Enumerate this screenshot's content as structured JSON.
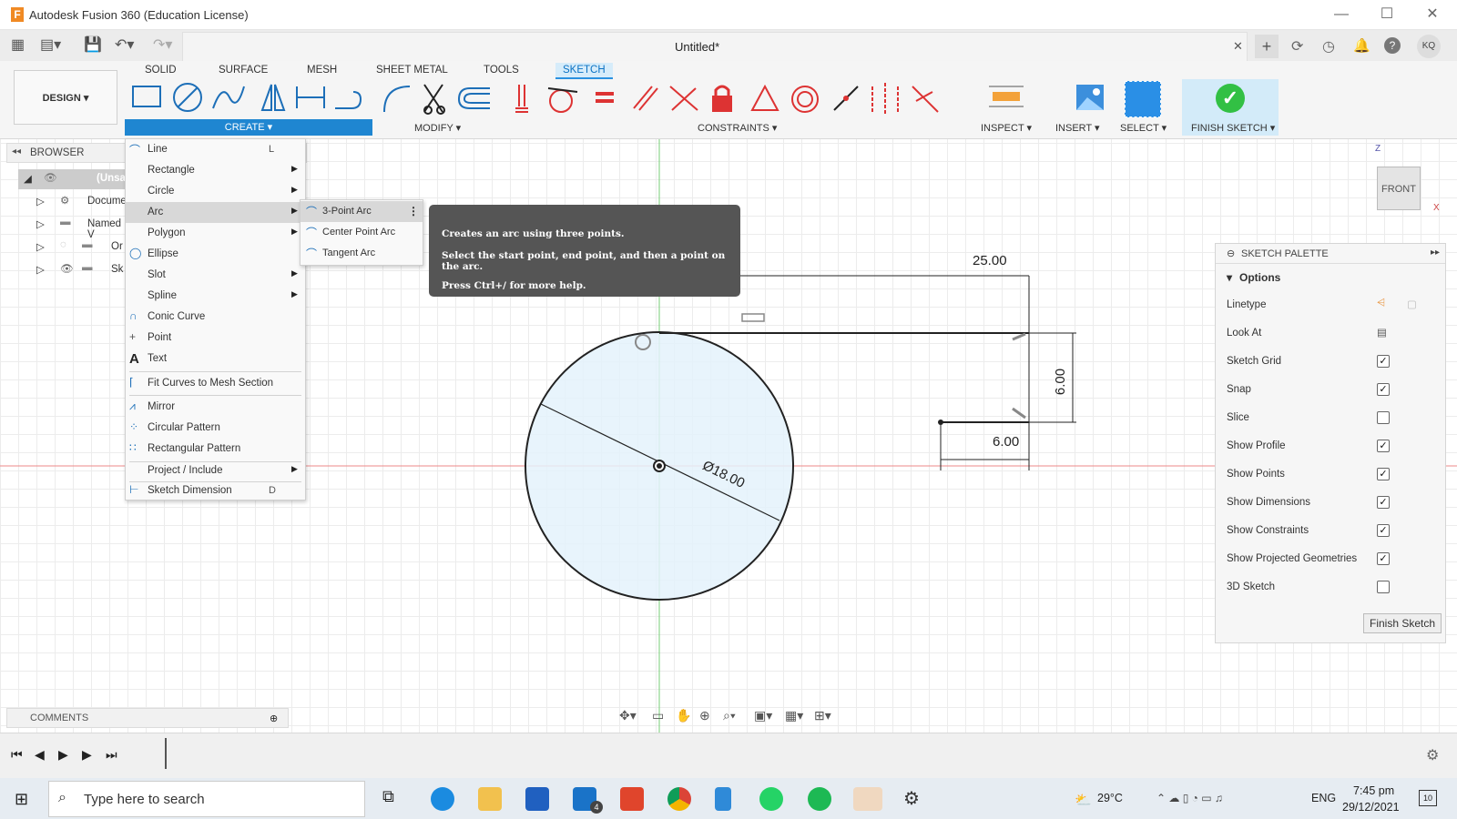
{
  "window": {
    "title": "Autodesk Fusion 360 (Education License)",
    "logo_letter": "F",
    "min": "—",
    "max": "☐",
    "close": "✕"
  },
  "document": {
    "tab_title": "Untitled*",
    "close": "✕",
    "user_initials": "KQ"
  },
  "ribbon": {
    "workspace": "DESIGN ▾",
    "tabs": [
      "SOLID",
      "SURFACE",
      "MESH",
      "SHEET METAL",
      "TOOLS",
      "SKETCH"
    ],
    "active_tab": "SKETCH",
    "groups": {
      "create": "CREATE ▾",
      "modify": "MODIFY ▾",
      "constraints": "CONSTRAINTS ▾",
      "inspect": "INSPECT ▾",
      "insert": "INSERT ▾",
      "select": "SELECT ▾",
      "finish": "FINISH SKETCH ▾"
    },
    "accent": "#1f86d1"
  },
  "browser": {
    "label": "BROWSER",
    "items": [
      "(Unsa",
      "Docume",
      "Named V",
      "Or",
      "Sk"
    ]
  },
  "create_menu": {
    "items": [
      {
        "label": "Line",
        "shortcut": "L",
        "has_sub": false
      },
      {
        "label": "Rectangle",
        "shortcut": "",
        "has_sub": true
      },
      {
        "label": "Circle",
        "shortcut": "",
        "has_sub": true
      },
      {
        "label": "Arc",
        "shortcut": "",
        "has_sub": true
      },
      {
        "label": "Polygon",
        "shortcut": "",
        "has_sub": true
      },
      {
        "label": "Ellipse",
        "shortcut": "",
        "has_sub": false
      },
      {
        "label": "Slot",
        "shortcut": "",
        "has_sub": true
      },
      {
        "label": "Spline",
        "shortcut": "",
        "has_sub": true
      },
      {
        "label": "Conic Curve",
        "shortcut": "",
        "has_sub": false
      },
      {
        "label": "Point",
        "shortcut": "",
        "has_sub": false
      },
      {
        "label": "Text",
        "shortcut": "",
        "has_sub": false
      },
      {
        "label": "Fit Curves to Mesh Section",
        "shortcut": "",
        "has_sub": false
      },
      {
        "label": "Mirror",
        "shortcut": "",
        "has_sub": false
      },
      {
        "label": "Circular Pattern",
        "shortcut": "",
        "has_sub": false
      },
      {
        "label": "Rectangular Pattern",
        "shortcut": "",
        "has_sub": false
      },
      {
        "label": "Project / Include",
        "shortcut": "",
        "has_sub": true
      },
      {
        "label": "Sketch Dimension",
        "shortcut": "D",
        "has_sub": false
      }
    ],
    "highlighted": "Arc"
  },
  "arc_submenu": {
    "items": [
      "3-Point Arc",
      "Center Point Arc",
      "Tangent Arc"
    ],
    "more": "⋮"
  },
  "tooltip": {
    "line1": "Creates an arc using three points.",
    "line2": "Select the start point, end point, and then a point on the arc.",
    "line3": "Press Ctrl+/ for more help."
  },
  "sketch": {
    "dims": {
      "width": "25.00",
      "height": "6.00",
      "small": "6.00",
      "diameter": "Ø18.00"
    }
  },
  "viewcube": {
    "face": "FRONT",
    "z": "Z",
    "x": "X"
  },
  "palette": {
    "title": "SKETCH PALETTE",
    "section": "Options",
    "rows": [
      {
        "label": "Linetype",
        "type": "icons"
      },
      {
        "label": "Look At",
        "type": "icon"
      },
      {
        "label": "Sketch Grid",
        "checked": true
      },
      {
        "label": "Snap",
        "checked": true
      },
      {
        "label": "Slice",
        "checked": false
      },
      {
        "label": "Show Profile",
        "checked": true
      },
      {
        "label": "Show Points",
        "checked": true
      },
      {
        "label": "Show Dimensions",
        "checked": true
      },
      {
        "label": "Show Constraints",
        "checked": true
      },
      {
        "label": "Show Projected Geometries",
        "checked": true
      },
      {
        "label": "3D Sketch",
        "checked": false
      }
    ],
    "finish_button": "Finish Sketch"
  },
  "comments": {
    "label": "COMMENTS"
  },
  "taskbar": {
    "search_placeholder": "Type here to search",
    "mail_badge": "4",
    "weather": "29°C",
    "lang": "ENG",
    "time": "7:45 pm",
    "date": "29/12/2021",
    "notif": "10"
  }
}
